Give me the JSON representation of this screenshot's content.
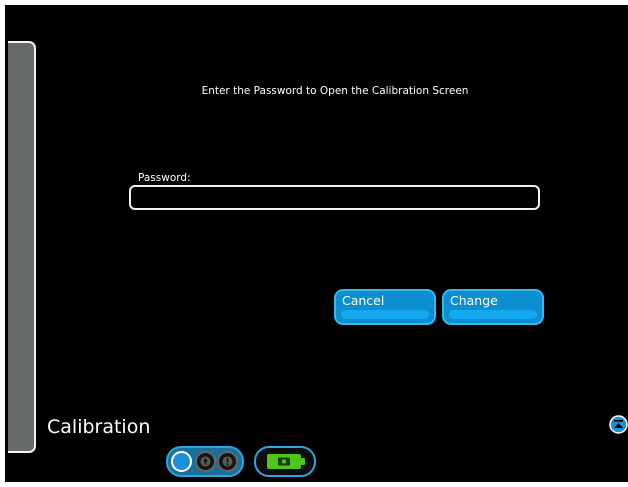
{
  "dialog": {
    "prompt": "Enter the Password to Open the Calibration Screen",
    "password_label": "Password:",
    "password_value": "",
    "cancel_label": "Cancel",
    "change_label": "Change"
  },
  "footer": {
    "title": "Calibration"
  },
  "status": {
    "indicators": [
      "connection-indicator",
      "upload-indicator",
      "warning-indicator"
    ],
    "battery_icon": "battery-charging-icon"
  },
  "colors": {
    "background": "#000000",
    "side_panel": "#676b69",
    "button_fill": "#0b8fd0",
    "button_border": "#35b8f0",
    "battery_green": "#4fc61a"
  }
}
